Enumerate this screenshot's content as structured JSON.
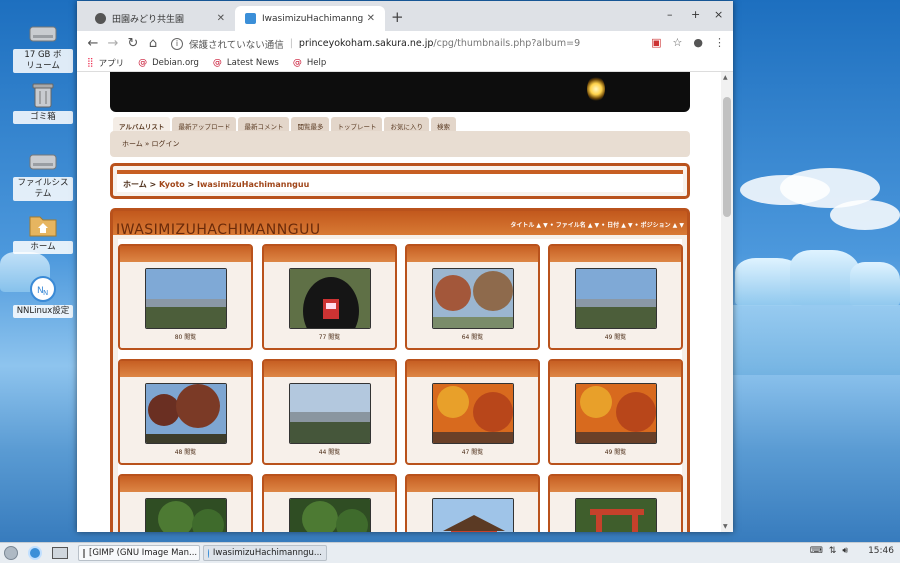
{
  "desktop": {
    "icons": [
      {
        "label": "17 GB ボ\nリューム",
        "name": "volume"
      },
      {
        "label": "ゴミ箱",
        "name": "trash"
      },
      {
        "label": "ファイルシステム",
        "name": "filesystem"
      },
      {
        "label": "ホーム",
        "name": "home"
      },
      {
        "label": "NNLinux設定",
        "name": "settings"
      }
    ]
  },
  "browser": {
    "tabs": [
      {
        "title": "田園みどり共生園",
        "active": false
      },
      {
        "title": "IwasimizuHachimannguu",
        "active": true
      }
    ],
    "new_tab": "+",
    "controls": {
      "minimize": "–",
      "maximize": "+",
      "close": "×"
    },
    "address": {
      "security": "保護されていない通信",
      "host": "princeyokoham.sakura.ne.jp",
      "path": "/cpg/thumbnails.php?album=9"
    },
    "bookmarks": [
      "アプリ",
      "Debian.org",
      "Latest News",
      "Help"
    ]
  },
  "page": {
    "nav_tabs": [
      "アルバムリスト",
      "最新アップロード",
      "最新コメント",
      "閲覧最多",
      "トップレート",
      "お気に入り",
      "検索"
    ],
    "breadcrumb_top": "ホーム » ログイン",
    "breadcrumb": {
      "home": "ホーム",
      "sep1": " > ",
      "cat": "Kyoto",
      "sep2": " > ",
      "album": "IwasimizuHachimannguu"
    },
    "album_title": "IWASIMIZUHACHIMANNGUU",
    "sort_bar": "タイトル ▲ ▼ • ファイル名 ▲ ▼ • 日付 ▲ ▼ • ポジション ▲ ▼",
    "thumbnails": [
      {
        "views": "80 閲覧",
        "scene": "city"
      },
      {
        "views": "77 閲覧",
        "scene": "tunnel"
      },
      {
        "views": "64 閲覧",
        "scene": "autumn"
      },
      {
        "views": "49 閲覧",
        "scene": "city"
      },
      {
        "views": "48 閲覧",
        "scene": "trees"
      },
      {
        "views": "44 閲覧",
        "scene": "river"
      },
      {
        "views": "47 閲覧",
        "scene": "maple"
      },
      {
        "views": "49 閲覧",
        "scene": "maple"
      },
      {
        "views": "",
        "scene": "forest"
      },
      {
        "views": "",
        "scene": "forest"
      },
      {
        "views": "",
        "scene": "shrine"
      },
      {
        "views": "",
        "scene": "gate"
      }
    ]
  },
  "taskbar": {
    "windows": [
      "[GIMP (GNU Image Man...",
      "IwasimizuHachimanngu..."
    ],
    "clock": "15:46"
  }
}
